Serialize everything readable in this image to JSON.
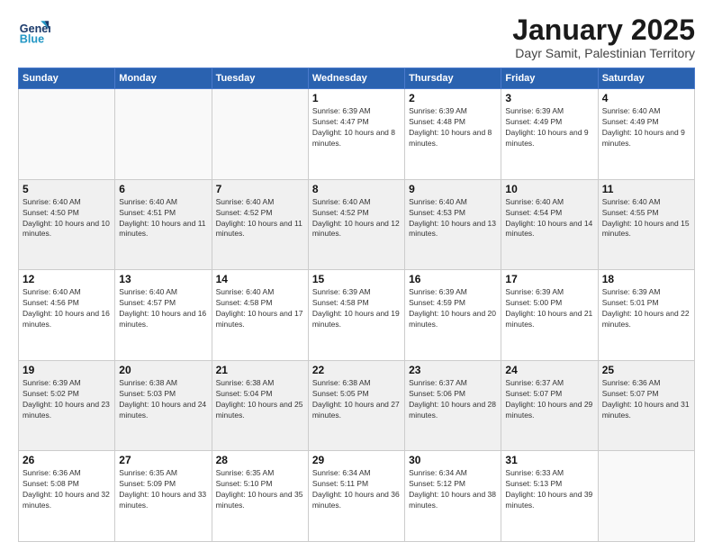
{
  "logo": {
    "line1": "General",
    "line2": "Blue"
  },
  "title": "January 2025",
  "subtitle": "Dayr Samit, Palestinian Territory",
  "weekdays": [
    "Sunday",
    "Monday",
    "Tuesday",
    "Wednesday",
    "Thursday",
    "Friday",
    "Saturday"
  ],
  "weeks": [
    [
      {
        "day": "",
        "info": ""
      },
      {
        "day": "",
        "info": ""
      },
      {
        "day": "",
        "info": ""
      },
      {
        "day": "1",
        "info": "Sunrise: 6:39 AM\nSunset: 4:47 PM\nDaylight: 10 hours and 8 minutes."
      },
      {
        "day": "2",
        "info": "Sunrise: 6:39 AM\nSunset: 4:48 PM\nDaylight: 10 hours and 8 minutes."
      },
      {
        "day": "3",
        "info": "Sunrise: 6:39 AM\nSunset: 4:49 PM\nDaylight: 10 hours and 9 minutes."
      },
      {
        "day": "4",
        "info": "Sunrise: 6:40 AM\nSunset: 4:49 PM\nDaylight: 10 hours and 9 minutes."
      }
    ],
    [
      {
        "day": "5",
        "info": "Sunrise: 6:40 AM\nSunset: 4:50 PM\nDaylight: 10 hours and 10 minutes."
      },
      {
        "day": "6",
        "info": "Sunrise: 6:40 AM\nSunset: 4:51 PM\nDaylight: 10 hours and 11 minutes."
      },
      {
        "day": "7",
        "info": "Sunrise: 6:40 AM\nSunset: 4:52 PM\nDaylight: 10 hours and 11 minutes."
      },
      {
        "day": "8",
        "info": "Sunrise: 6:40 AM\nSunset: 4:52 PM\nDaylight: 10 hours and 12 minutes."
      },
      {
        "day": "9",
        "info": "Sunrise: 6:40 AM\nSunset: 4:53 PM\nDaylight: 10 hours and 13 minutes."
      },
      {
        "day": "10",
        "info": "Sunrise: 6:40 AM\nSunset: 4:54 PM\nDaylight: 10 hours and 14 minutes."
      },
      {
        "day": "11",
        "info": "Sunrise: 6:40 AM\nSunset: 4:55 PM\nDaylight: 10 hours and 15 minutes."
      }
    ],
    [
      {
        "day": "12",
        "info": "Sunrise: 6:40 AM\nSunset: 4:56 PM\nDaylight: 10 hours and 16 minutes."
      },
      {
        "day": "13",
        "info": "Sunrise: 6:40 AM\nSunset: 4:57 PM\nDaylight: 10 hours and 16 minutes."
      },
      {
        "day": "14",
        "info": "Sunrise: 6:40 AM\nSunset: 4:58 PM\nDaylight: 10 hours and 17 minutes."
      },
      {
        "day": "15",
        "info": "Sunrise: 6:39 AM\nSunset: 4:58 PM\nDaylight: 10 hours and 19 minutes."
      },
      {
        "day": "16",
        "info": "Sunrise: 6:39 AM\nSunset: 4:59 PM\nDaylight: 10 hours and 20 minutes."
      },
      {
        "day": "17",
        "info": "Sunrise: 6:39 AM\nSunset: 5:00 PM\nDaylight: 10 hours and 21 minutes."
      },
      {
        "day": "18",
        "info": "Sunrise: 6:39 AM\nSunset: 5:01 PM\nDaylight: 10 hours and 22 minutes."
      }
    ],
    [
      {
        "day": "19",
        "info": "Sunrise: 6:39 AM\nSunset: 5:02 PM\nDaylight: 10 hours and 23 minutes."
      },
      {
        "day": "20",
        "info": "Sunrise: 6:38 AM\nSunset: 5:03 PM\nDaylight: 10 hours and 24 minutes."
      },
      {
        "day": "21",
        "info": "Sunrise: 6:38 AM\nSunset: 5:04 PM\nDaylight: 10 hours and 25 minutes."
      },
      {
        "day": "22",
        "info": "Sunrise: 6:38 AM\nSunset: 5:05 PM\nDaylight: 10 hours and 27 minutes."
      },
      {
        "day": "23",
        "info": "Sunrise: 6:37 AM\nSunset: 5:06 PM\nDaylight: 10 hours and 28 minutes."
      },
      {
        "day": "24",
        "info": "Sunrise: 6:37 AM\nSunset: 5:07 PM\nDaylight: 10 hours and 29 minutes."
      },
      {
        "day": "25",
        "info": "Sunrise: 6:36 AM\nSunset: 5:07 PM\nDaylight: 10 hours and 31 minutes."
      }
    ],
    [
      {
        "day": "26",
        "info": "Sunrise: 6:36 AM\nSunset: 5:08 PM\nDaylight: 10 hours and 32 minutes."
      },
      {
        "day": "27",
        "info": "Sunrise: 6:35 AM\nSunset: 5:09 PM\nDaylight: 10 hours and 33 minutes."
      },
      {
        "day": "28",
        "info": "Sunrise: 6:35 AM\nSunset: 5:10 PM\nDaylight: 10 hours and 35 minutes."
      },
      {
        "day": "29",
        "info": "Sunrise: 6:34 AM\nSunset: 5:11 PM\nDaylight: 10 hours and 36 minutes."
      },
      {
        "day": "30",
        "info": "Sunrise: 6:34 AM\nSunset: 5:12 PM\nDaylight: 10 hours and 38 minutes."
      },
      {
        "day": "31",
        "info": "Sunrise: 6:33 AM\nSunset: 5:13 PM\nDaylight: 10 hours and 39 minutes."
      },
      {
        "day": "",
        "info": ""
      }
    ]
  ]
}
